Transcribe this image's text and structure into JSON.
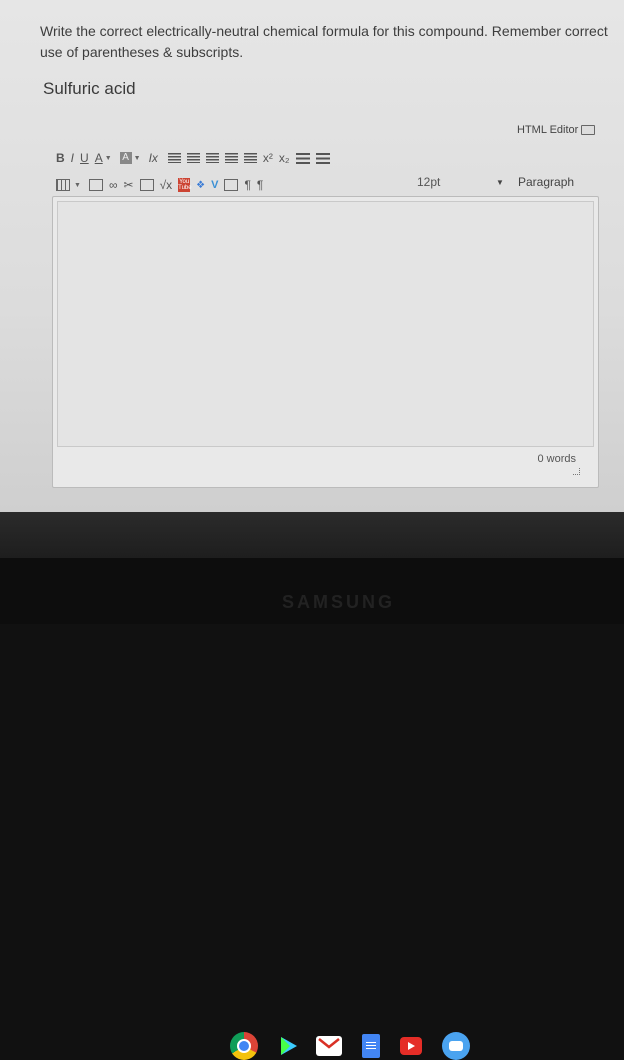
{
  "question": {
    "text": "Write the correct electrically-neutral chemical formula for this compound. Remember correct use of parentheses & subscripts.",
    "compound": "Sulfuric acid"
  },
  "editor": {
    "html_editor_label": "HTML Editor",
    "font_size": "12pt",
    "paragraph_label": "Paragraph",
    "word_count": "0 words",
    "toolbar_row1": {
      "bold": "B",
      "italic": "I",
      "underline": "U",
      "font_color": "A",
      "highlight": "A",
      "clear_format": "Ix",
      "superscript": "x²",
      "subscript": "x₂"
    },
    "toolbar_row2": {
      "math": "√x",
      "youtube": "You Tube",
      "ltr": "¶",
      "rtl": "¶"
    }
  },
  "shelf": {
    "apps": [
      "chrome-icon",
      "play-store-icon",
      "gmail-icon",
      "docs-icon",
      "youtube-icon",
      "messages-icon"
    ]
  },
  "device": {
    "brand": "SAMSUNG"
  }
}
